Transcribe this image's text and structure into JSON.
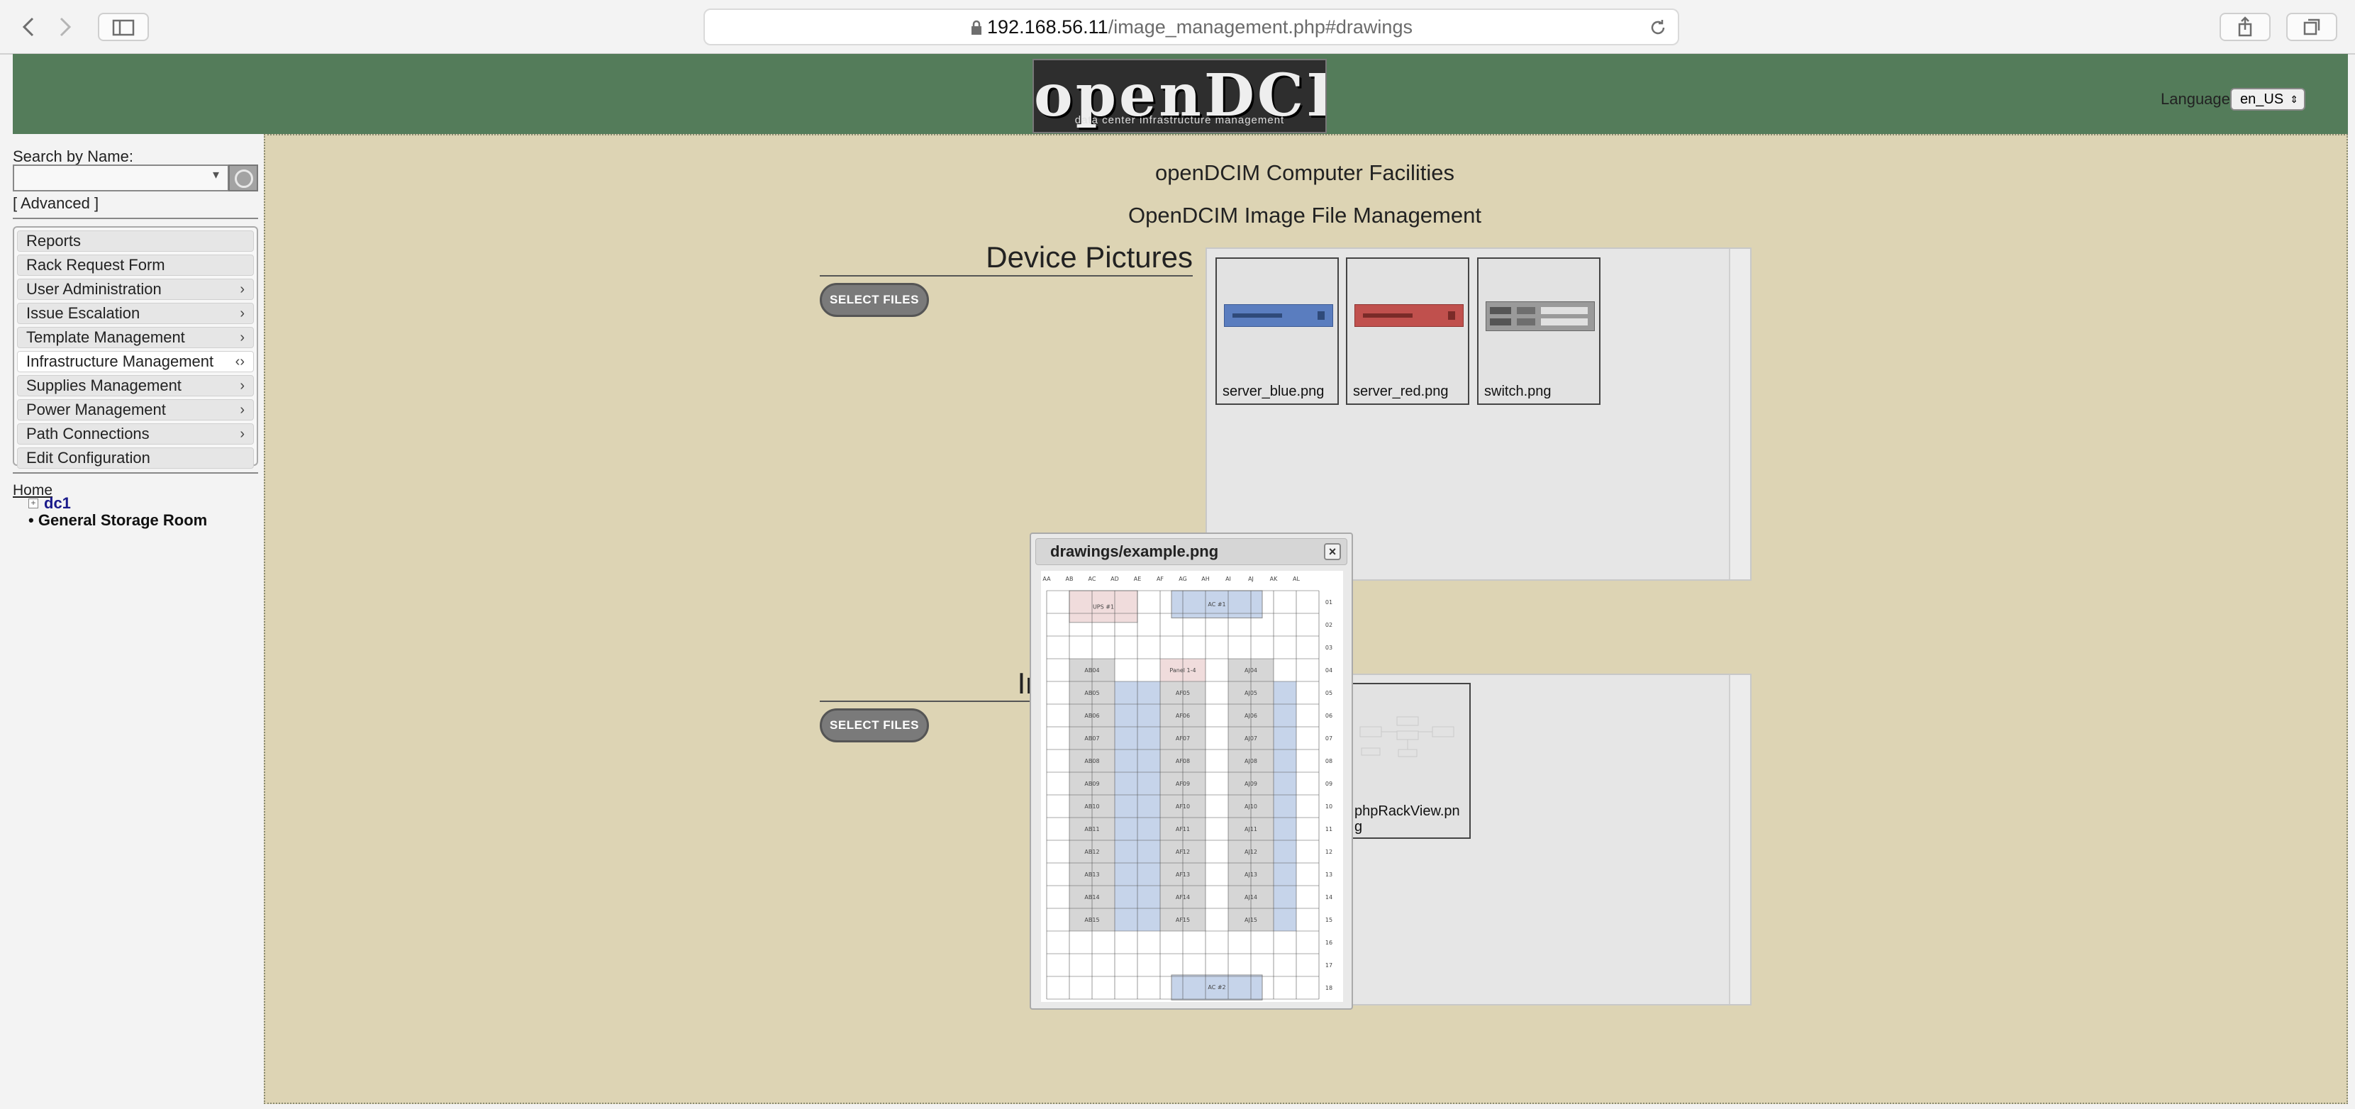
{
  "browser": {
    "url_host": "192.168.56.11",
    "url_path": "/image_management.php#drawings",
    "icons": [
      "back-icon",
      "forward-icon",
      "sidebar-icon",
      "lock-icon",
      "reload-icon",
      "share-icon",
      "tabs-icon"
    ]
  },
  "header": {
    "logo_text": "openDCIM",
    "logo_subtext": "data center infrastructure management",
    "language_label": "Language",
    "language_value": "en_US"
  },
  "sidebar": {
    "search_label": "Search by Name:",
    "advanced_label": "[ Advanced ]",
    "menu": [
      {
        "label": "Reports",
        "chevron": ""
      },
      {
        "label": "Rack Request Form",
        "chevron": ""
      },
      {
        "label": "User Administration",
        "chevron": "›"
      },
      {
        "label": "Issue Escalation",
        "chevron": "›"
      },
      {
        "label": "Template Management",
        "chevron": "›"
      },
      {
        "label": "Infrastructure Management",
        "chevron": "‹›"
      },
      {
        "label": "Supplies Management",
        "chevron": "›"
      },
      {
        "label": "Power Management",
        "chevron": "›"
      },
      {
        "label": "Path Connections",
        "chevron": "›"
      },
      {
        "label": "Edit Configuration",
        "chevron": ""
      }
    ],
    "tree": {
      "home": "Home",
      "dc": "dc1",
      "room": "General Storage Room",
      "expand": "+"
    }
  },
  "main": {
    "site_title": "openDCIM Computer Facilities",
    "page_title": "OpenDCIM Image File Management",
    "device_section_title": "Device Pictures",
    "infra_section_title": "Infrastructure",
    "select_files_label": "SELECT FILES",
    "device_images": [
      "server_blue.png",
      "server_red.png",
      "switch.png"
    ],
    "infra_images": [
      "phpRackView.pn",
      "g"
    ]
  },
  "dialog": {
    "title": "drawings/example.png",
    "close": "×",
    "drawing": {
      "columns": [
        "AA",
        "AB",
        "AC",
        "AD",
        "AE",
        "AF",
        "AG",
        "AH",
        "AI",
        "AJ",
        "AK",
        "AL"
      ],
      "rows": [
        "01",
        "02",
        "03",
        "04",
        "05",
        "06",
        "07",
        "08",
        "09",
        "10",
        "11",
        "12",
        "13",
        "14",
        "15",
        "16",
        "17",
        "18"
      ],
      "labels": {
        "ups": "UPS #1",
        "ac1": "AC #1",
        "ac2": "AC #2",
        "panel": "Panel 1-4",
        "ab": [
          "AB04",
          "AB05",
          "AB06",
          "AB07",
          "AB08",
          "AB09",
          "AB10",
          "AB11",
          "AB12",
          "AB13",
          "AB14",
          "AB15"
        ],
        "af": [
          "AF05",
          "AF06",
          "AF07",
          "AF08",
          "AF09",
          "AF10",
          "AF11",
          "AF12",
          "AF13",
          "AF14",
          "AF15"
        ],
        "aj": [
          "AJ04",
          "AJ05",
          "AJ06",
          "AJ07",
          "AJ08",
          "AJ09",
          "AJ10",
          "AJ11",
          "AJ12",
          "AJ13",
          "AJ14",
          "AJ15"
        ]
      }
    }
  },
  "colors": {
    "header_bg": "#547c5a",
    "content_bg": "#ddd4b4",
    "server_blue": "#5a7dbf",
    "server_red": "#c0504d",
    "cold_aisle": "#c6d4ea",
    "ups_fill": "#f0dcdc"
  }
}
